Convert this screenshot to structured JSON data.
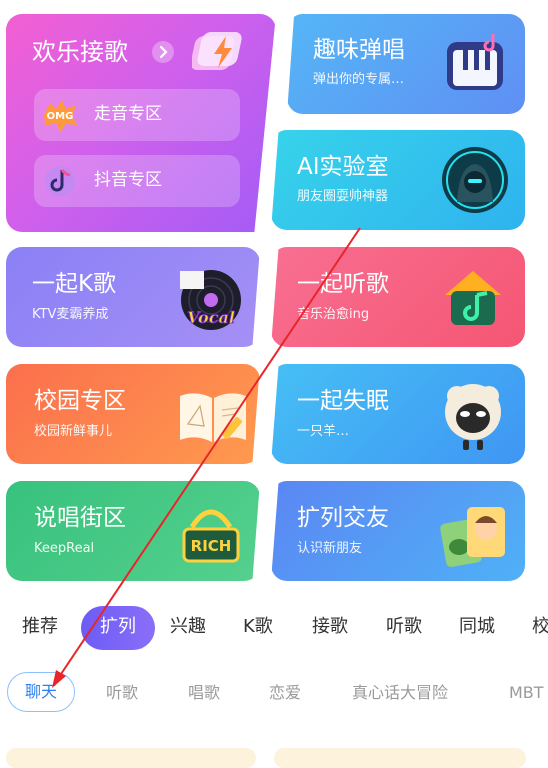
{
  "cards": {
    "huanle": {
      "title": "欢乐接歌",
      "pill1": "走音专区",
      "pill2": "抖音专区"
    },
    "quwei": {
      "title": "趣味弹唱",
      "sub": "弹出你的专属…"
    },
    "ai": {
      "title": "AI实验室",
      "sub": "朋友圈耍帅神器"
    },
    "k": {
      "title": "一起K歌",
      "sub": "KTV麦霸养成",
      "art_text": "Vocal"
    },
    "ting": {
      "title": "一起听歌",
      "sub": "音乐治愈ing"
    },
    "xiao": {
      "title": "校园专区",
      "sub": "校园新鲜事儿"
    },
    "shimian": {
      "title": "一起失眠",
      "sub": "一只羊…"
    },
    "shuochang": {
      "title": "说唱街区",
      "sub": "KeepReal",
      "art_text": "RICH"
    },
    "kuolie": {
      "title": "扩列交友",
      "sub": "认识新朋友"
    }
  },
  "tabs": [
    "推荐",
    "扩列",
    "兴趣",
    "K歌",
    "接歌",
    "听歌",
    "同城",
    "校"
  ],
  "active_tab": "扩列",
  "subtabs": [
    "聊天",
    "听歌",
    "唱歌",
    "恋爱",
    "真心话大冒险",
    "MBT"
  ],
  "active_subtab": "聊天",
  "colors": {
    "accent": "#6c5cf6",
    "annotation": "#e8262a",
    "subtab_active": "#2f80ed"
  }
}
